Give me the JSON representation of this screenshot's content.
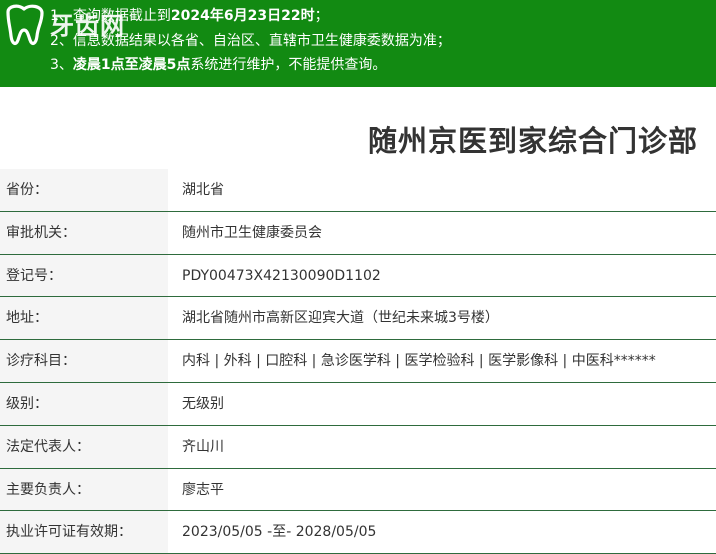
{
  "banner": {
    "logo_text": "牙齿网",
    "notices": [
      {
        "prefix": "1、",
        "plain": "查询数据截止到",
        "bold": "2024年6月23日22时",
        "suffix": "；"
      },
      {
        "prefix": "2、",
        "plain": "信息数据结果以各省、自治区、直辖市卫生健康委数据为准；",
        "bold": "",
        "suffix": ""
      },
      {
        "prefix": "3、",
        "plain": "",
        "bold": "凌晨1点至凌晨5点",
        "suffix": "系统进行维护，不能提供查询。"
      }
    ],
    "color": "#128a12"
  },
  "clinic": {
    "name": "随州京医到家综合门诊部"
  },
  "info_rows": [
    {
      "label": "省份：",
      "value": "湖北省"
    },
    {
      "label": "审批机关：",
      "value": "随州市卫生健康委员会"
    },
    {
      "label": "登记号：",
      "value": "PDY00473X42130090D1102"
    },
    {
      "label": "地址：",
      "value": "湖北省随州市高新区迎宾大道（世纪未来城3号楼）"
    },
    {
      "label": "诊疗科目：",
      "value": "内科 | 外科 | 口腔科 | 急诊医学科 | 医学检验科 | 医学影像科 | 中医科******"
    },
    {
      "label": "级别：",
      "value": "无级别"
    },
    {
      "label": "法定代表人：",
      "value": "齐山川"
    },
    {
      "label": "主要负责人：",
      "value": "廖志平"
    },
    {
      "label": "执业许可证有效期：",
      "value": "2023/05/05 -至- 2028/05/05"
    }
  ]
}
